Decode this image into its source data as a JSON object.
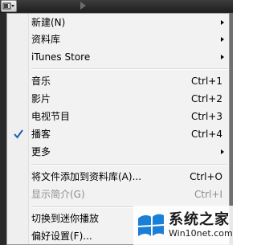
{
  "colors": {
    "menu_background": "#f2f2f2",
    "disabled_text": "#8d8d8d",
    "checkmark": "#1c5fb0",
    "toolbar_dark": "#2a2a2a"
  },
  "toolbar": {
    "app_menu_icon": "itunes-menu-icon",
    "play_icon": "play-icon"
  },
  "menu": {
    "items": [
      {
        "label": "新建(N)",
        "shortcut": "",
        "submenu": true,
        "checked": false,
        "disabled": false
      },
      {
        "label": "资料库",
        "shortcut": "",
        "submenu": true,
        "checked": false,
        "disabled": false
      },
      {
        "label": "iTunes Store",
        "shortcut": "",
        "submenu": true,
        "checked": false,
        "disabled": false
      },
      {
        "label": "音乐",
        "shortcut": "Ctrl+1",
        "submenu": false,
        "checked": false,
        "disabled": false
      },
      {
        "label": "影片",
        "shortcut": "Ctrl+2",
        "submenu": false,
        "checked": false,
        "disabled": false
      },
      {
        "label": "电视节目",
        "shortcut": "Ctrl+3",
        "submenu": false,
        "checked": false,
        "disabled": false
      },
      {
        "label": "播客",
        "shortcut": "Ctrl+4",
        "submenu": false,
        "checked": true,
        "disabled": false
      },
      {
        "label": "更多",
        "shortcut": "",
        "submenu": true,
        "checked": false,
        "disabled": false
      },
      {
        "label": "将文件添加到资料库(A)...",
        "shortcut": "Ctrl+O",
        "submenu": false,
        "checked": false,
        "disabled": false
      },
      {
        "label": "显示简介(G)",
        "shortcut": "Ctrl+I",
        "submenu": false,
        "checked": false,
        "disabled": true
      },
      {
        "label": "切换到迷你播放",
        "shortcut": "",
        "submenu": false,
        "checked": false,
        "disabled": false
      },
      {
        "label": "偏好设置(F)...",
        "shortcut": "",
        "submenu": false,
        "checked": false,
        "disabled": false
      }
    ]
  },
  "watermark": {
    "title": "系统之家",
    "url": "Win10net.com",
    "logo_icon": "windows-logo-icon"
  }
}
